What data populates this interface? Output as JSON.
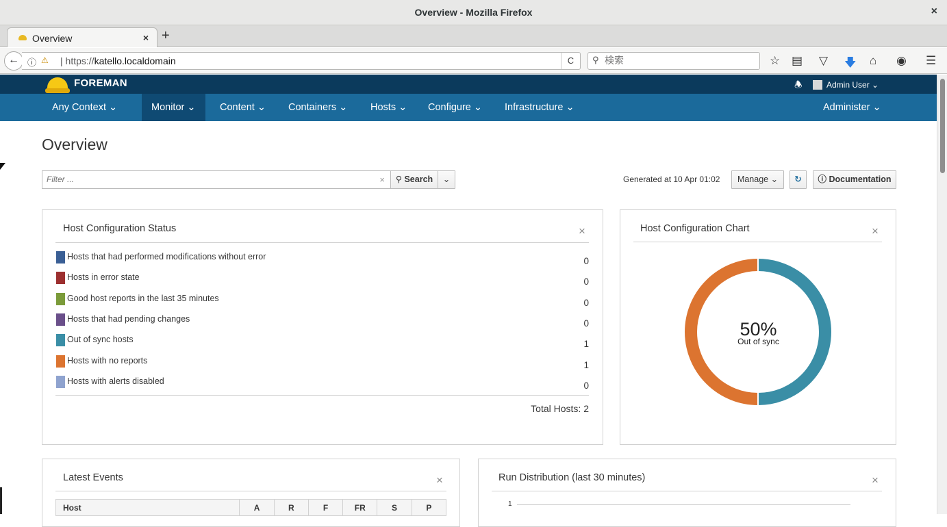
{
  "window": {
    "title": "Overview - Mozilla Firefox",
    "close": "×"
  },
  "browser": {
    "tab_label": "Overview",
    "tab_close": "×",
    "new_tab": "+",
    "url_prefix": "https://",
    "url_host": "katello.localdomain",
    "search_placeholder": "検索",
    "reload": "C"
  },
  "foreman": {
    "brand": "FOREMAN",
    "user": "Admin User ⌄",
    "nav": [
      {
        "label": "Any Context  ⌄"
      },
      {
        "label": "Monitor ⌄"
      },
      {
        "label": "Content ⌄"
      },
      {
        "label": "Containers ⌄"
      },
      {
        "label": "Hosts ⌄"
      },
      {
        "label": "Configure ⌄"
      },
      {
        "label": "Infrastructure ⌄"
      },
      {
        "label": "Administer ⌄"
      }
    ]
  },
  "page": {
    "title": "Overview",
    "filter_placeholder": "Filter ...",
    "filter_clear": "×",
    "search_label": "Search",
    "generated": "Generated at 10 Apr 01:02",
    "manage_label": "Manage ⌄",
    "documentation_label": "Documentation"
  },
  "status_card": {
    "title": "Host Configuration Status",
    "close": "×",
    "rows": [
      {
        "label": "Hosts that had performed modifications without error",
        "count": "0",
        "color": "#3a5f95"
      },
      {
        "label": "Hosts in error state",
        "count": "0",
        "color": "#9c2f2f"
      },
      {
        "label": "Good host reports in the last 35 minutes",
        "count": "0",
        "color": "#7b9b3a"
      },
      {
        "label": "Hosts that had pending changes",
        "count": "0",
        "color": "#6a4f8a"
      },
      {
        "label": "Out of sync hosts",
        "count": "1",
        "color": "#3a8ea6"
      },
      {
        "label": "Hosts with no reports",
        "count": "1",
        "color": "#dc7430"
      },
      {
        "label": "Hosts with alerts disabled",
        "count": "0",
        "color": "#8fa3cf"
      }
    ],
    "total": "Total Hosts: 2"
  },
  "chart_card": {
    "title": "Host Configuration Chart",
    "close": "×",
    "center_value": "50%",
    "center_label": "Out of sync"
  },
  "chart_data": {
    "type": "pie",
    "categories": [
      "Out of sync hosts",
      "Hosts with no reports"
    ],
    "values": [
      1,
      1
    ],
    "colors": [
      "#3a8ea6",
      "#dc7430"
    ]
  },
  "events_card": {
    "title": "Latest Events",
    "close": "×",
    "columns": [
      "Host",
      "A",
      "R",
      "F",
      "FR",
      "S",
      "P"
    ]
  },
  "run_card": {
    "title": "Run Distribution (last 30 minutes)",
    "close": "×",
    "y_tick": "1"
  }
}
